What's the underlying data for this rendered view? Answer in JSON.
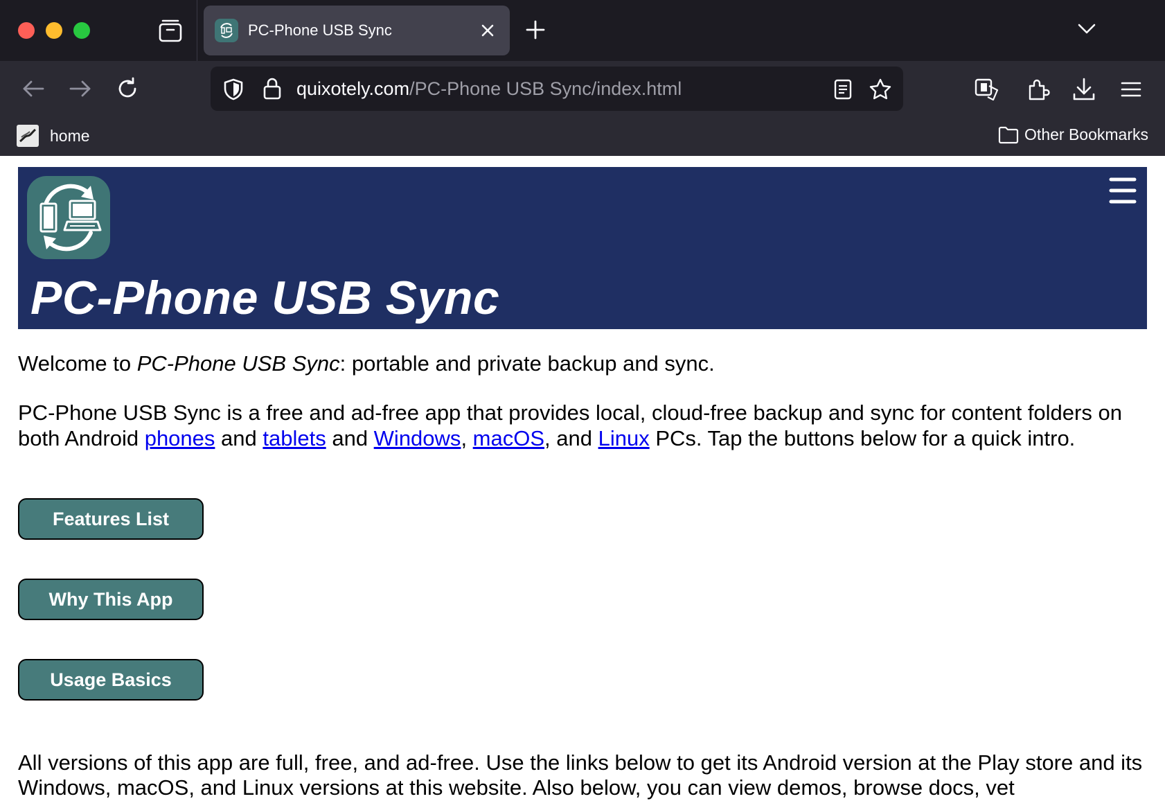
{
  "browser": {
    "tab": {
      "title": "PC-Phone USB Sync"
    },
    "url": {
      "domain": "quixotely.com",
      "path": "/PC-Phone USB Sync/index.html"
    },
    "bookmarks": {
      "home_label": "home",
      "other_label": "Other Bookmarks"
    }
  },
  "banner": {
    "title": "PC-Phone USB Sync",
    "bg_color": "#1f2f63",
    "logo_color": "#3f7575"
  },
  "content": {
    "welcome_prefix": "Welcome to ",
    "welcome_app": "PC-Phone USB Sync",
    "welcome_suffix": ": portable and private backup and sync.",
    "intro_part1": "PC-Phone USB Sync is a free and ad-free app that provides local, cloud-free backup and sync for content folders on both Android ",
    "link_phones": "phones",
    "intro_and1": " and ",
    "link_tablets": "tablets",
    "intro_and2": " and ",
    "link_windows": "Windows",
    "intro_comma1": ", ",
    "link_macos": "macOS",
    "intro_comma2": ", and ",
    "link_linux": "Linux",
    "intro_part2": " PCs. Tap the buttons below for a quick intro.",
    "buttons": {
      "features": "Features List",
      "why": "Why This App",
      "usage": "Usage Basics"
    },
    "button_color": "#477b7b",
    "outro": "All versions of this app are full, free, and ad-free. Use the links below to get its Android version at the Play store and its Windows, macOS, and Linux versions at this website. Also below, you can view demos, browse docs, vet"
  }
}
